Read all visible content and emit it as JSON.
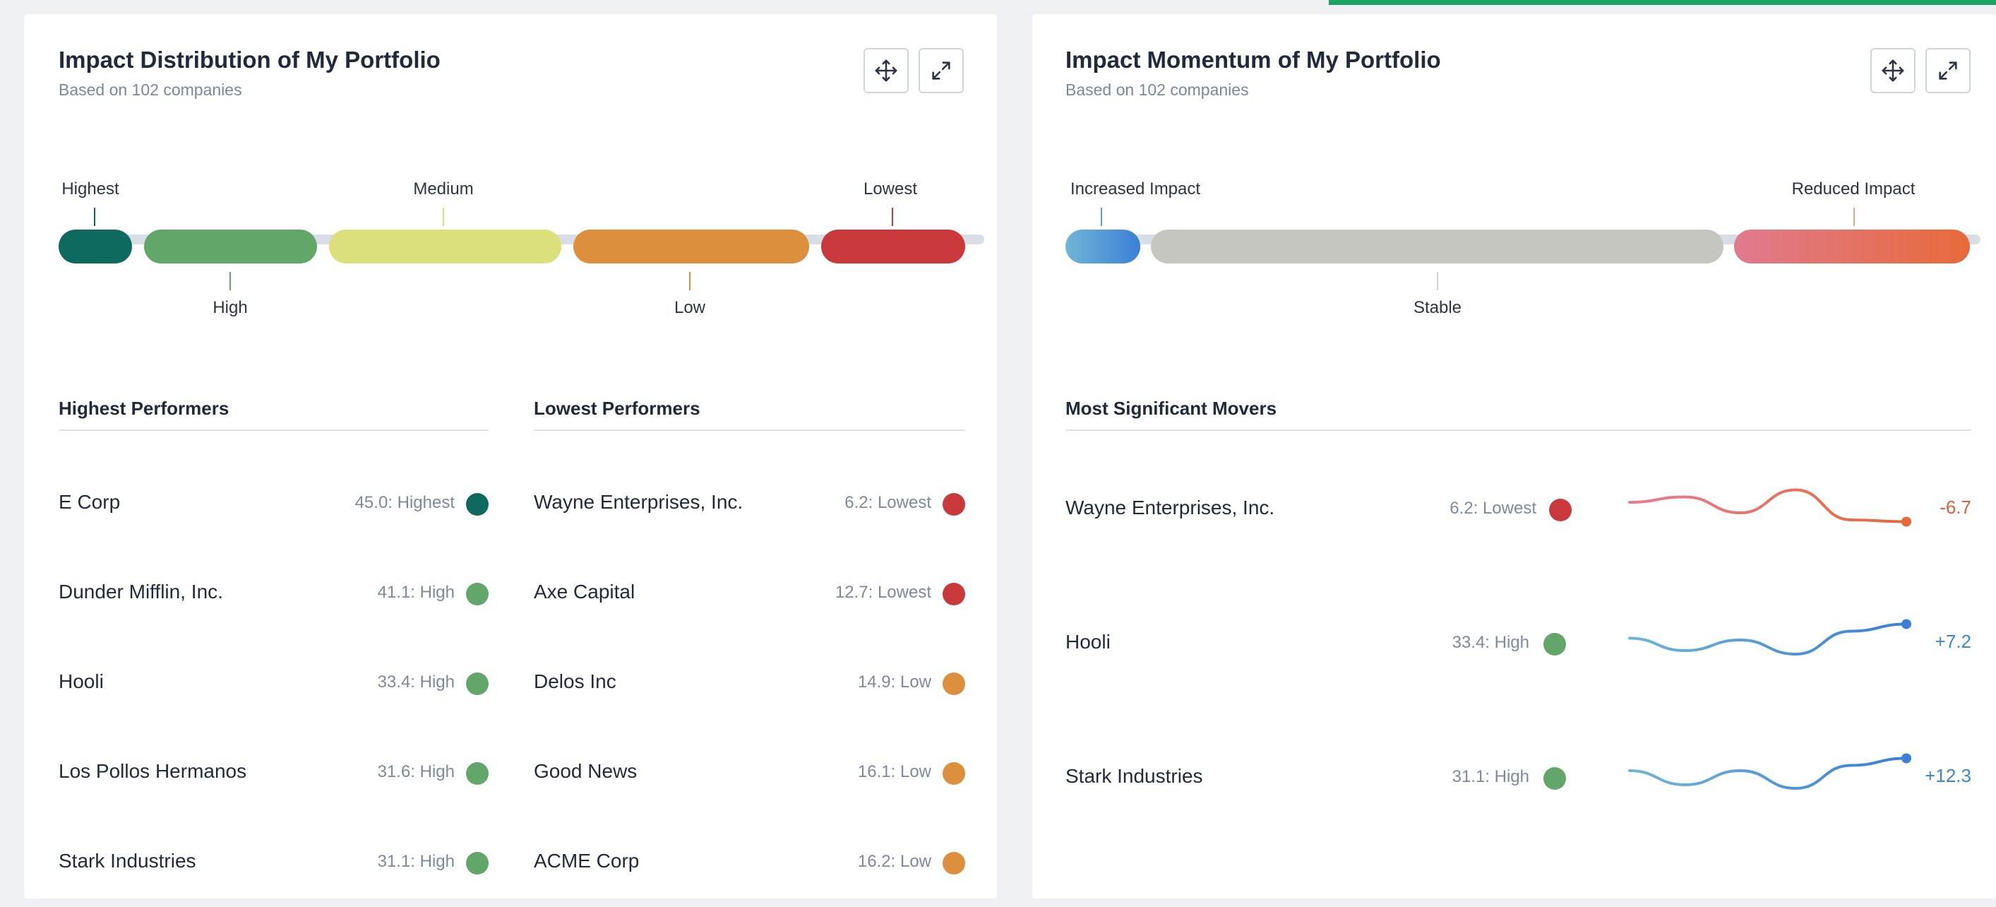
{
  "colors": {
    "highest": "#0e6a5e",
    "high": "#62a66a",
    "medium": "#dbe07a",
    "low": "#de8f3d",
    "lowest": "#c9393b",
    "stable": "#c4c6bf",
    "increased": "#3b7fd6",
    "reduced": "#e86a3a",
    "negative_text": "#e0603c",
    "positive_text": "#3a86d8"
  },
  "distribution": {
    "title": "Impact Distribution of My Portfolio",
    "subtitle": "Based on 102 companies",
    "scale": {
      "highest": "Highest",
      "high": "High",
      "medium": "Medium",
      "low": "Low",
      "lowest": "Lowest"
    },
    "highest_performers": {
      "title": "Highest Performers",
      "rows": [
        {
          "name": "E Corp",
          "score": "45.0: Highest",
          "level": "highest"
        },
        {
          "name": "Dunder Mifflin, Inc.",
          "score": "41.1: High",
          "level": "high"
        },
        {
          "name": "Hooli",
          "score": "33.4: High",
          "level": "high"
        },
        {
          "name": "Los Pollos Hermanos",
          "score": "31.6: High",
          "level": "high"
        },
        {
          "name": "Stark Industries",
          "score": "31.1: High",
          "level": "high"
        }
      ]
    },
    "lowest_performers": {
      "title": "Lowest Performers",
      "rows": [
        {
          "name": "Wayne Enterprises, Inc.",
          "score": "6.2: Lowest",
          "level": "lowest"
        },
        {
          "name": "Axe Capital",
          "score": "12.7: Lowest",
          "level": "lowest"
        },
        {
          "name": "Delos Inc",
          "score": "14.9: Low",
          "level": "low"
        },
        {
          "name": "Good News",
          "score": "16.1: Low",
          "level": "low"
        },
        {
          "name": "ACME Corp",
          "score": "16.2: Low",
          "level": "low"
        }
      ]
    }
  },
  "momentum": {
    "title": "Impact Momentum of My Portfolio",
    "subtitle": "Based on 102 companies",
    "scale": {
      "increased": "Increased Impact",
      "stable": "Stable",
      "reduced": "Reduced Impact"
    },
    "movers": {
      "title": "Most Significant Movers",
      "rows": [
        {
          "name": "Wayne Enterprises, Inc.",
          "score": "6.2: Lowest",
          "level": "lowest",
          "delta": "-6.7",
          "direction": "negative",
          "trend": [
            0.6,
            0.75,
            0.3,
            0.95,
            0.1,
            0.05
          ]
        },
        {
          "name": "Hooli",
          "score": "33.4: High",
          "level": "high",
          "delta": "+7.2",
          "direction": "positive",
          "trend": [
            0.55,
            0.2,
            0.5,
            0.1,
            0.75,
            0.95
          ]
        },
        {
          "name": "Stark Industries",
          "score": "31.1: High",
          "level": "high",
          "delta": "+12.3",
          "direction": "positive",
          "trend": [
            0.6,
            0.2,
            0.6,
            0.1,
            0.75,
            0.95
          ]
        }
      ]
    }
  },
  "icons": {
    "move": "move-icon",
    "expand": "expand-icon"
  }
}
